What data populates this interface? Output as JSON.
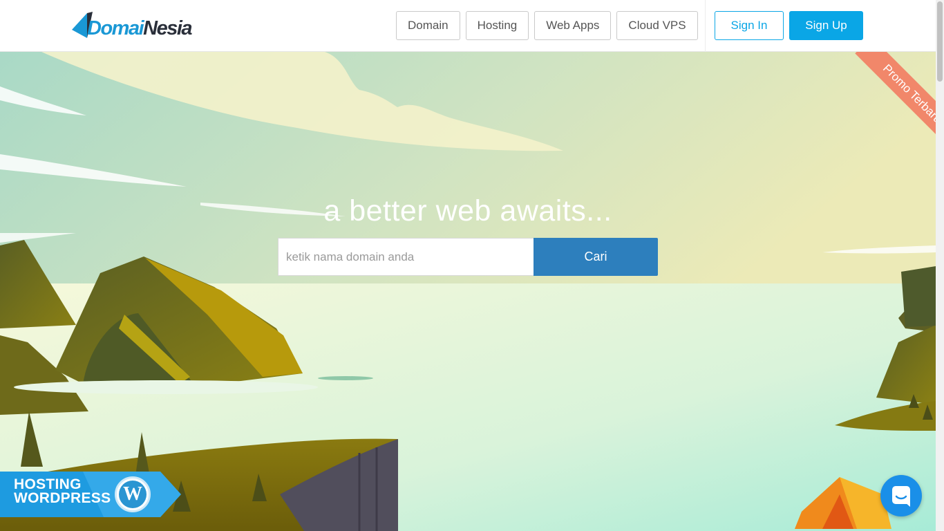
{
  "brand": {
    "logo_part1": "Domai",
    "logo_part2": "Nesia"
  },
  "nav": {
    "items": [
      {
        "label": "Domain"
      },
      {
        "label": "Hosting"
      },
      {
        "label": "Web Apps"
      },
      {
        "label": "Cloud VPS"
      }
    ],
    "sign_in": "Sign In",
    "sign_up": "Sign Up"
  },
  "hero": {
    "tagline": "a better web awaits...",
    "search": {
      "placeholder": "ketik nama domain anda",
      "value": "",
      "button": "Cari"
    },
    "promo_ribbon": "Promo Terbaru",
    "wp_banner": {
      "line1": "HOSTING",
      "line2": "WORDPRESS",
      "logo_glyph": "W"
    }
  },
  "icons": {
    "chat": "chat-bubble-icon",
    "wordpress": "wordpress-icon"
  },
  "colors": {
    "brand_blue": "#0aa6e6",
    "search_button": "#2d7fbd",
    "promo": "#f1876a",
    "chat": "#1a8fe8"
  }
}
